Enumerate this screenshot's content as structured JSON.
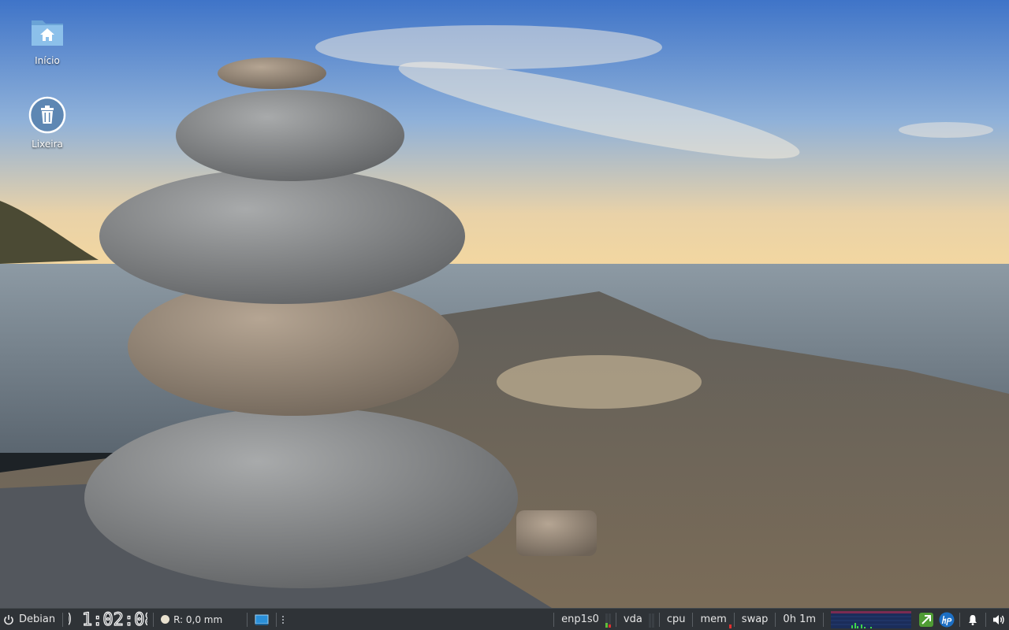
{
  "desktop": {
    "icons": [
      {
        "label": "Início",
        "icon": "home-folder-icon"
      },
      {
        "label": "Lixeira",
        "icon": "trash-icon"
      }
    ]
  },
  "panel": {
    "start_label": "Debian",
    "clock_text": "0 1:02:08",
    "weather_text": "R: 0,0 mm",
    "network_label": "enp1s0",
    "disk_label": "vda",
    "cpu_label": "cpu",
    "mem_label": "mem",
    "swap_label": "swap",
    "uptime_label": "0h 1m"
  },
  "colors": {
    "panel_bg": "#2f3337",
    "graph_bg": "#1b2d5a",
    "accent_green": "#5fbf3a",
    "accent_red": "#e03030",
    "hp_blue": "#1c6fc4"
  }
}
